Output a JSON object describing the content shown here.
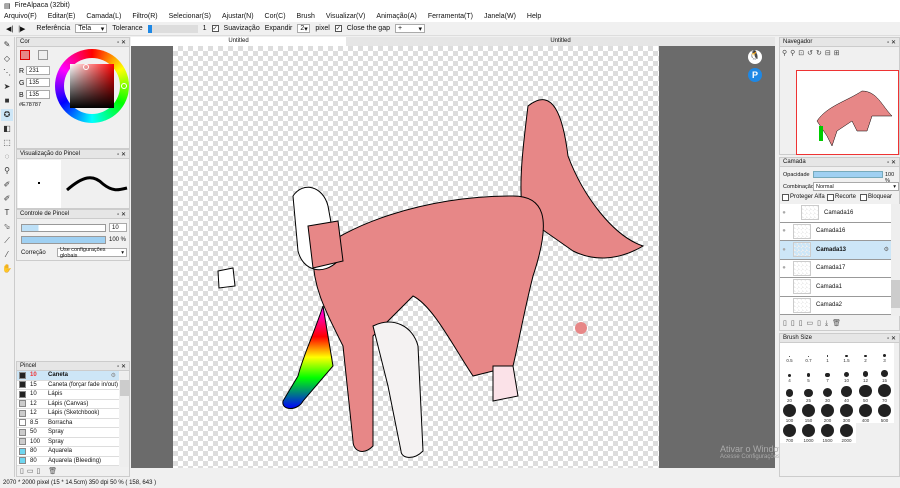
{
  "title": "FireAlpaca (32bit)",
  "menu": [
    "Arquivo(F)",
    "Editar(E)",
    "Camada(L)",
    "Filtro(R)",
    "Selecionar(S)",
    "Ajustar(N)",
    "Cor(C)",
    "Brush",
    "Visualizar(V)",
    "Animação(A)",
    "Ferramenta(T)",
    "Janela(W)",
    "Help"
  ],
  "toolbar": {
    "referencia_label": "Referência",
    "referencia_value": "Tela",
    "tolerance_label": "Tolerance",
    "tolerance_value": "1",
    "suavizacao_label": "Suavização",
    "expandir_label": "Expandir",
    "expandir_value": "2",
    "pixel_label": "pixel",
    "close_gap_label": "Close the gap",
    "close_gap_value": "+"
  },
  "tabs": [
    "Untitled",
    "Untitled"
  ],
  "color_panel": {
    "title": "Cor",
    "r": "231",
    "g": "135",
    "b": "135",
    "hex": "#E78787",
    "color": "#e78787"
  },
  "brush_preview": {
    "title": "Visualização do Pincel"
  },
  "brush_control": {
    "title": "Controle de Pincel",
    "size": "10",
    "opacity": "100 %",
    "opacity_value": 100,
    "correcao_label": "Correção",
    "correcao_value": "Use configurações globais"
  },
  "brush_list": {
    "title": "Pincel",
    "items": [
      {
        "size": "10",
        "name": "Caneta",
        "color": "#222",
        "selected": true
      },
      {
        "size": "15",
        "name": "Caneta (forçar fade in/out)",
        "color": "#222"
      },
      {
        "size": "10",
        "name": "Lápis",
        "color": "#222"
      },
      {
        "size": "12",
        "name": "Lápis (Canvas)",
        "color": "#ccc"
      },
      {
        "size": "12",
        "name": "Lápis (Sketchbook)",
        "color": "#ccc"
      },
      {
        "size": "8.5",
        "name": "Borracha",
        "color": "#fff"
      },
      {
        "size": "50",
        "name": "Spray",
        "color": "#ccc"
      },
      {
        "size": "100",
        "name": "Spray",
        "color": "#ccc"
      },
      {
        "size": "80",
        "name": "Aquarela",
        "color": "#6fd6f0"
      },
      {
        "size": "80",
        "name": "Aquarela (Bleeding)",
        "color": "#6fd6f0"
      }
    ]
  },
  "status": "2070 * 2000 pixel  (15 * 14.5cm)  350 dpi  50 %  ( 158, 643 )",
  "navigator": {
    "title": "Navegador"
  },
  "layers": {
    "title": "Camada",
    "opacity_label": "Opacidade",
    "opacity": "100 %",
    "opacity_value": 100,
    "blend_label": "Combinação",
    "blend_value": "Normal",
    "protect_alpha": "Proteger Alfa",
    "clip": "Recorte",
    "lock": "Bloquear",
    "items": [
      {
        "name": "Camada16"
      },
      {
        "name": "Camada16"
      },
      {
        "name": "Camada13",
        "selected": true
      },
      {
        "name": "Camada17"
      },
      {
        "name": "Camada1"
      },
      {
        "name": "Camada2"
      }
    ]
  },
  "brush_size": {
    "title": "Brush Size",
    "sizes": [
      "0.5",
      "0.7",
      "1",
      "1.5",
      "2",
      "3",
      "4",
      "5",
      "7",
      "10",
      "12",
      "15",
      "20",
      "25",
      "30",
      "40",
      "50",
      "70",
      "100",
      "150",
      "200",
      "300",
      "400",
      "500",
      "700",
      "1000",
      "1500",
      "2000"
    ]
  },
  "watermark": {
    "line1": "Ativar o Windows",
    "line2": "Acesse Configurações para ativar o Windows."
  }
}
